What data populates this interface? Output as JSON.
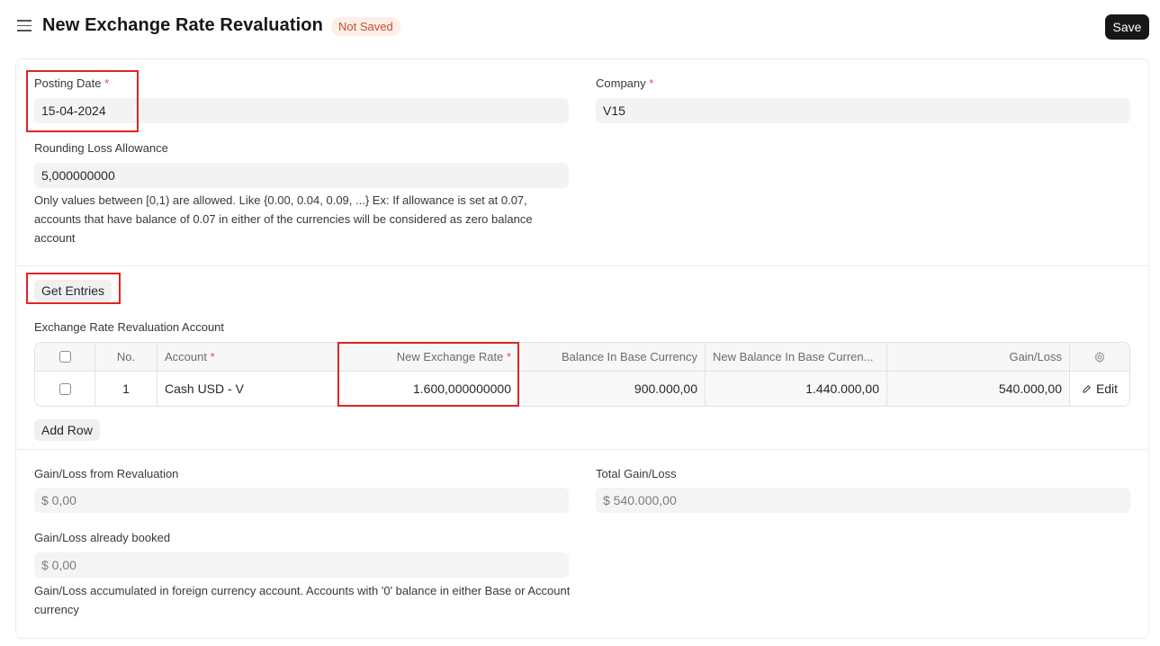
{
  "header": {
    "title": "New Exchange Rate Revaluation",
    "status": "Not Saved",
    "save_label": "Save"
  },
  "posting_date": {
    "label": "Posting Date",
    "required": "*",
    "value": "15-04-2024"
  },
  "company": {
    "label": "Company",
    "required": "*",
    "value": "V15"
  },
  "rounding": {
    "label": "Rounding Loss Allowance",
    "value": "5,000000000",
    "help": "Only values between [0,1) are allowed. Like {0.00, 0.04, 0.09, ...} Ex: If allowance is set at 0.07, accounts that have balance of 0.07 in either of the currencies will be considered as zero balance account"
  },
  "get_entries_label": "Get Entries",
  "accounts_table": {
    "label": "Exchange Rate Revaluation Account",
    "columns": {
      "no": "No.",
      "account": "Account",
      "new_rate": "New Exchange Rate",
      "balance_base": "Balance In Base Currency",
      "new_balance_base": "New Balance In Base Curren...",
      "gain_loss": "Gain/Loss"
    },
    "required": "*",
    "rows": [
      {
        "no": "1",
        "account": "Cash USD - V",
        "new_rate": "1.600,000000000",
        "balance_base": "900.000,00",
        "new_balance_base": "1.440.000,00",
        "gain_loss": "540.000,00",
        "edit": "Edit"
      }
    ],
    "add_row_label": "Add Row"
  },
  "totals": {
    "gain_loss_reval": {
      "label": "Gain/Loss from Revaluation",
      "value": "$ 0,00"
    },
    "total_gain_loss": {
      "label": "Total Gain/Loss",
      "value": "$ 540.000,00"
    },
    "gain_loss_booked": {
      "label": "Gain/Loss already booked",
      "value": "$ 0,00"
    },
    "help": "Gain/Loss accumulated in foreign currency account. Accounts with '0' balance in either Base or Account currency"
  }
}
